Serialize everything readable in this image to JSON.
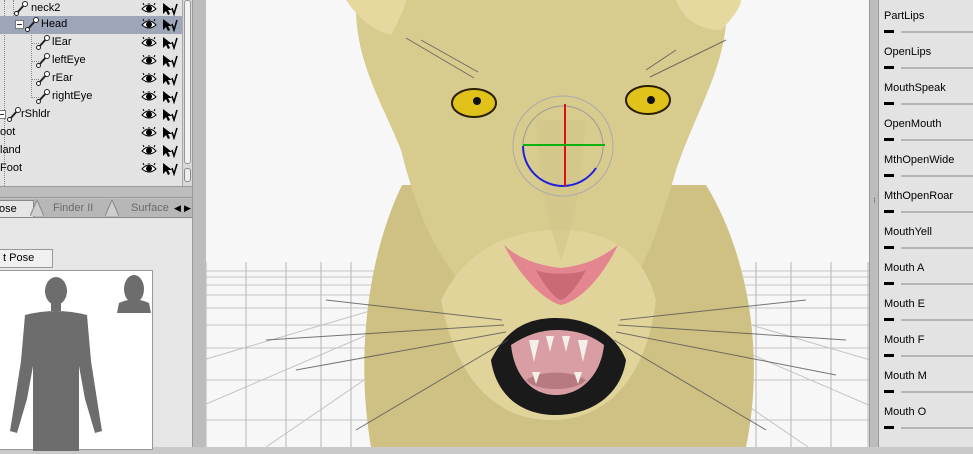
{
  "scene_tree": {
    "rows": [
      {
        "label": "neck2",
        "selected": false
      },
      {
        "label": "Head",
        "selected": true
      },
      {
        "label": "lEar",
        "selected": false
      },
      {
        "label": "leftEye",
        "selected": false
      },
      {
        "label": "rEar",
        "selected": false
      },
      {
        "label": "rightEye",
        "selected": false
      },
      {
        "label": "rShldr",
        "selected": false
      },
      {
        "label": "oot",
        "selected": false
      },
      {
        "label": "land",
        "selected": false
      },
      {
        "label": "Foot",
        "selected": false
      }
    ]
  },
  "tabs": {
    "pose": "ose",
    "finder": "Finder II",
    "surface": "Surface",
    "left_arrow": "◀",
    "right_arrow": "▶"
  },
  "pose_pane": {
    "button_label": "t Pose"
  },
  "parameters": [
    {
      "name": "PartLips",
      "value": "-"
    },
    {
      "name": "OpenLips",
      "value": "-"
    },
    {
      "name": "MouthSpeak",
      "value": "-"
    },
    {
      "name": "OpenMouth",
      "value": "-"
    },
    {
      "name": "MthOpenWide",
      "value": "-"
    },
    {
      "name": "MthOpenRoar",
      "value": "-"
    },
    {
      "name": "MouthYell",
      "value": "-"
    },
    {
      "name": "Mouth A",
      "value": "-"
    },
    {
      "name": "Mouth E",
      "value": "-"
    },
    {
      "name": "Mouth F",
      "value": "-"
    },
    {
      "name": "Mouth M",
      "value": "-"
    },
    {
      "name": "Mouth O",
      "value": "-"
    }
  ],
  "colors": {
    "selection": "#9ca6b8",
    "fur": "#d8cb8e",
    "eye": "#e1c21a",
    "nose": "#e3868f",
    "gizmo_red": "#e01010",
    "gizmo_green": "#10b010",
    "gizmo_blue": "#2020e0"
  }
}
